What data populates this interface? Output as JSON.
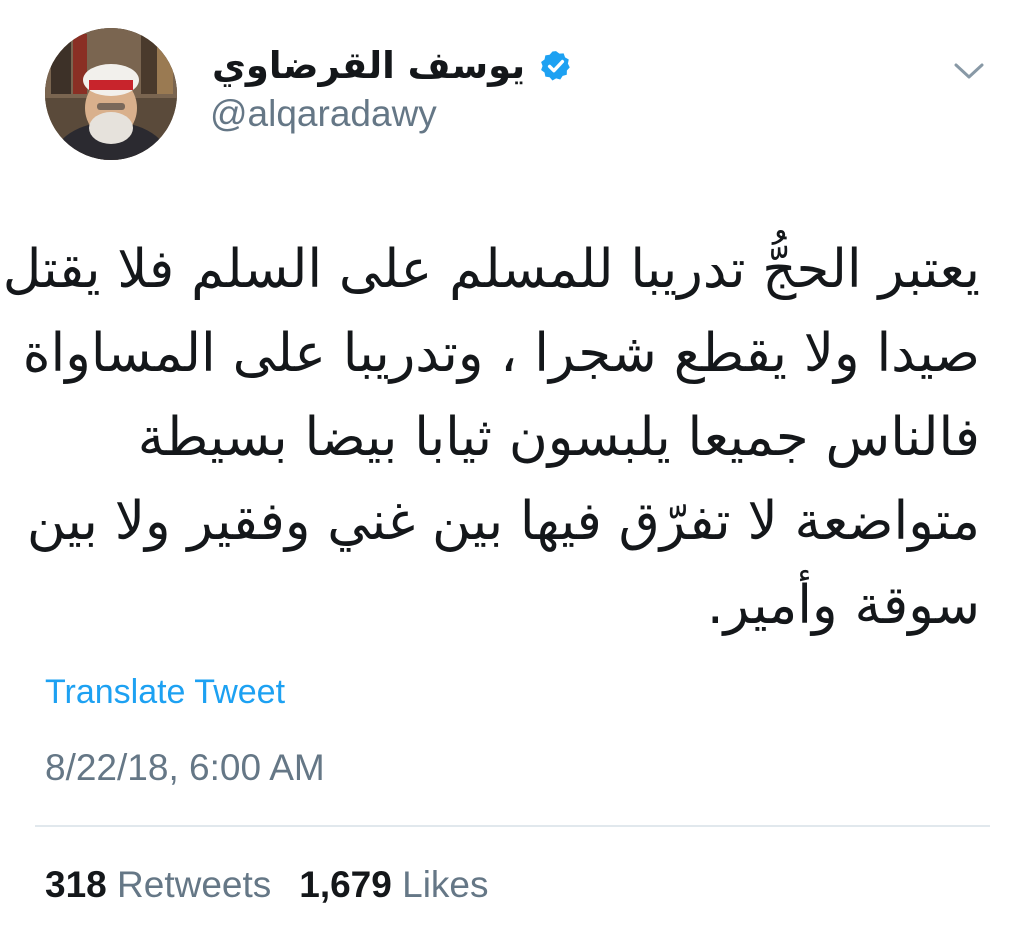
{
  "user": {
    "display_name": "يوسف القرضاوي",
    "handle": "@alqaradawy",
    "verified": true,
    "avatar_icon": "profile-photo"
  },
  "tweet": {
    "lines": [
      "يعتبر الحجُّ تدريبا للمسلم على السلم فلا يقتل",
      "صيدا ولا يقطع شجرا ، وتدريبا على المساواة",
      "فالناس جميعا يلبسون ثيابا بيضا بسيطة",
      "متواضعة لا تفرّق فيها بين غني وفقير ولا بين",
      "سوقة وأمير."
    ],
    "translate_label": "Translate Tweet",
    "timestamp": "8/22/18, 6:00 AM"
  },
  "stats": {
    "retweets_count": "318",
    "retweets_label": "Retweets",
    "likes_count": "1,679",
    "likes_label": "Likes"
  },
  "colors": {
    "text": "#14171a",
    "secondary": "#657786",
    "link": "#1da1f2",
    "divider": "#e1e8ed"
  },
  "icons": {
    "verified": "verified-badge-icon",
    "menu": "chevron-down-icon"
  }
}
